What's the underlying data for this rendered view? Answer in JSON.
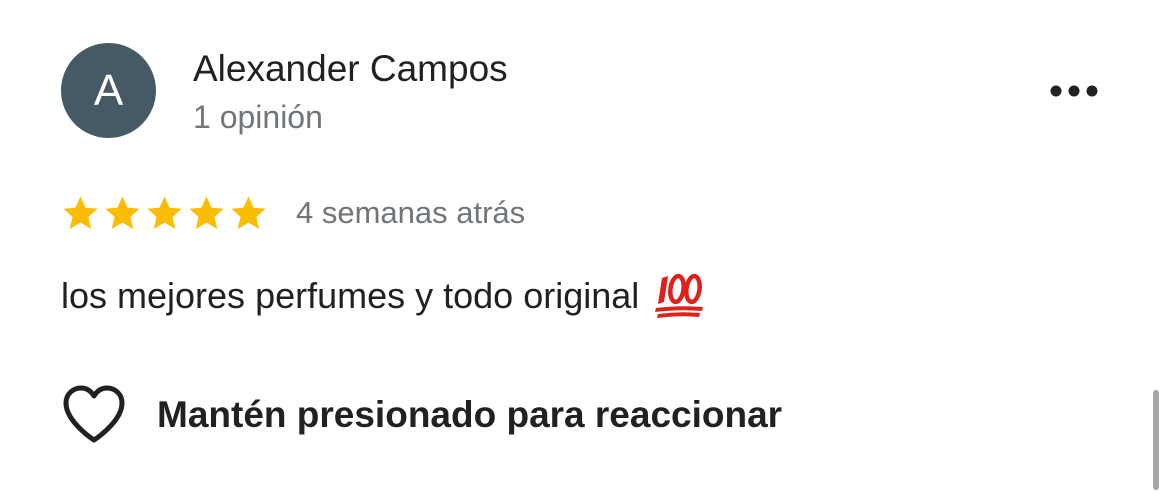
{
  "author": {
    "initial": "A",
    "name": "Alexander Campos",
    "meta": "1 opinión",
    "avatar_color": "#455a64"
  },
  "menu": {
    "icon": "more-horizontal-icon"
  },
  "review": {
    "rating": 5,
    "rating_max": 5,
    "star_color": "#fbbc04",
    "date": "4 semanas atrás",
    "text": "los mejores perfumes y todo original",
    "emoji": "hundred-points-emoji"
  },
  "reaction": {
    "icon": "heart-outline-icon",
    "label": "Mantén presionado para reaccionar"
  }
}
